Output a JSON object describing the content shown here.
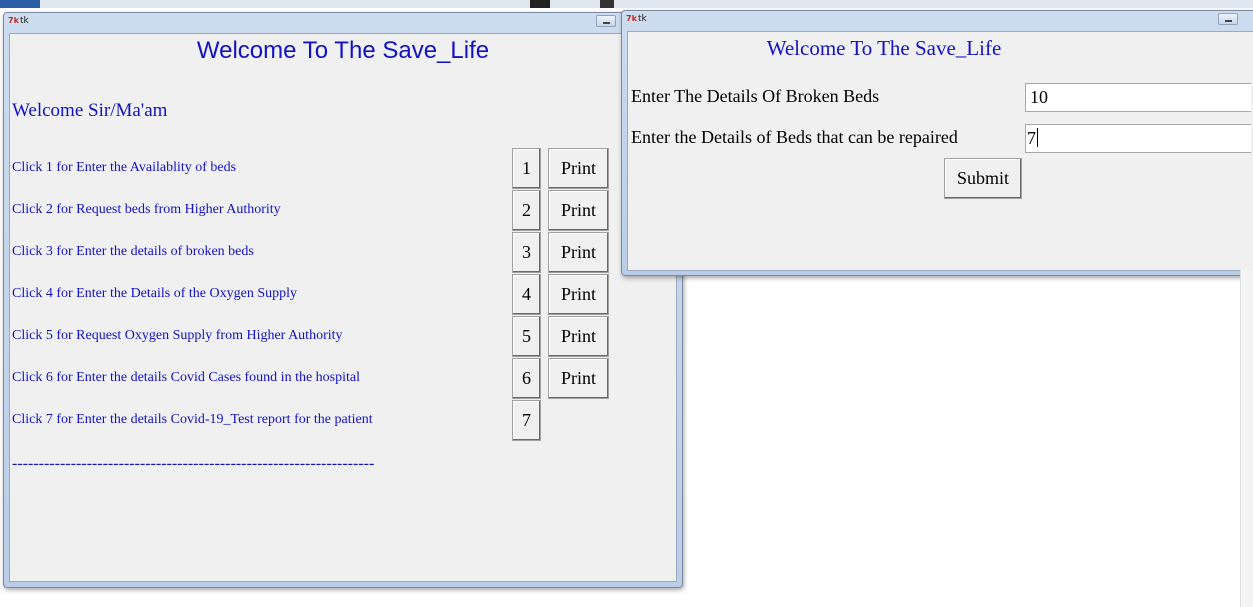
{
  "main_window": {
    "title": "tk",
    "icon": "tk-feather-icon",
    "heading": "Welcome To The Save_Life",
    "greeting": "Welcome Sir/Ma'am",
    "options": [
      {
        "label": "Click 1 for Enter the Availablity of beds",
        "number": "1",
        "print": "Print"
      },
      {
        "label": "Click 2 for Request beds from Higher Authority",
        "number": "2",
        "print": "Print"
      },
      {
        "label": "Click 3 for Enter the details of broken beds",
        "number": "3",
        "print": "Print"
      },
      {
        "label": "Click 4 for Enter the Details of the Oxygen Supply",
        "number": "4",
        "print": "Print"
      },
      {
        "label": "Click 5 for Request Oxygen Supply from Higher Authority",
        "number": "5",
        "print": "Print"
      },
      {
        "label": "Click 6 for Enter the details Covid Cases found in the hospital",
        "number": "6",
        "print": "Print"
      },
      {
        "label": "Click 7 for Enter the details Covid-19_Test report for the patient",
        "number": "7"
      }
    ],
    "separator": "--------------------------------------------------------------------"
  },
  "detail_window": {
    "title": "tk",
    "heading": "Welcome To The Save_Life",
    "fields": [
      {
        "label": "Enter The Details Of Broken Beds",
        "value": "10"
      },
      {
        "label": "Enter the Details of Beds that can be repaired",
        "value": "7"
      }
    ],
    "submit_label": "Submit"
  },
  "colors": {
    "text_blue": "#1212c4",
    "client_bg": "#f0f0f0",
    "titlebar": "#c4d5ec"
  }
}
